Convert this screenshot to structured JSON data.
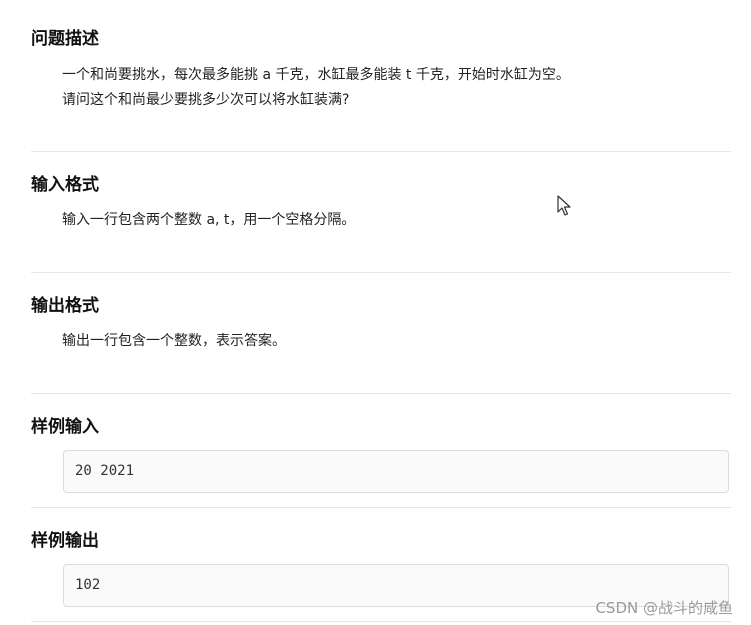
{
  "sections": {
    "description": {
      "title": "问题描述",
      "line1": "一个和尚要挑水，每次最多能挑 a 千克，水缸最多能装 t 千克，开始时水缸为空。",
      "line2": "请问这个和尚最少要挑多少次可以将水缸装满?"
    },
    "input_format": {
      "title": "输入格式",
      "text": "输入一行包含两个整数 a, t，用一个空格分隔。"
    },
    "output_format": {
      "title": "输出格式",
      "text": "输出一行包含一个整数，表示答案。"
    },
    "sample_input": {
      "title": "样例输入",
      "code": "20 2021"
    },
    "sample_output": {
      "title": "样例输出",
      "code": "102"
    }
  },
  "watermark": "CSDN @战斗的咸鱼",
  "icons": {
    "cursor": "mouse-pointer-icon"
  }
}
